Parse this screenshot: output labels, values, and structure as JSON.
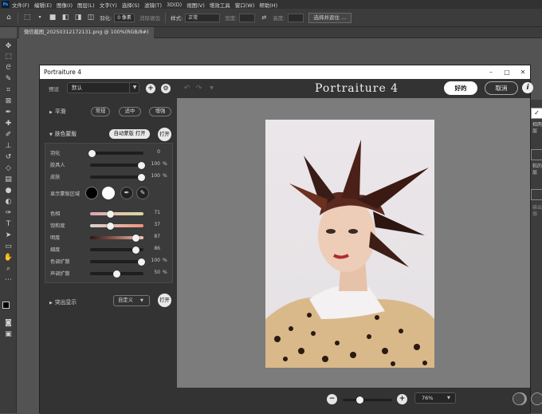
{
  "app": {
    "logo": "Ps",
    "menu": [
      "文件(F)",
      "编辑(E)",
      "图像(I)",
      "图层(L)",
      "文字(Y)",
      "选择(S)",
      "滤镜(T)",
      "3D(D)",
      "视图(V)",
      "增效工具",
      "窗口(W)",
      "帮助(H)"
    ]
  },
  "options": {
    "feather_label": "羽化:",
    "feather_value": "0 像素",
    "antialias_label": "消除锯齿",
    "style_label": "样式:",
    "style_value": "正常",
    "width_label": "宽度:",
    "height_label": "高度:",
    "select_mask_button": "选择并遮住 ..."
  },
  "document": {
    "tab_title": "微信截图_20250312172131.png @ 100%(RGB/8#)"
  },
  "right_panel": {
    "text1": "相两 层",
    "text2": "粘的 层",
    "text3": "输出 器"
  },
  "plugin": {
    "window_title": "Portraiture 4",
    "brand": "Portraiture 4",
    "preset_label": "预设",
    "preset_value": "默认",
    "ok_label": "好的",
    "cancel_label": "取消",
    "sections": {
      "smoothing": {
        "title": "平滑",
        "options": [
          "常规",
          "适中",
          "增强"
        ],
        "selected": "适中"
      },
      "skin_mask": {
        "title": "肤色蒙版",
        "auto_mask_label": "自动蒙版 打开",
        "toggle_label": "打开",
        "sliders_top": [
          {
            "label": "羽化",
            "value": "0",
            "unit": "",
            "frac": 0.03
          },
          {
            "label": "胶具人",
            "value": "100",
            "unit": "%",
            "frac": 0.97
          },
          {
            "label": "皮肤",
            "value": "100",
            "unit": "%",
            "frac": 0.97
          }
        ],
        "show_mask_label": "显示蒙版区域",
        "sliders_color": [
          {
            "label": "色相",
            "value": "71",
            "unit": "",
            "frac": 0.38
          },
          {
            "label": "饱和度",
            "value": "37",
            "unit": "",
            "frac": 0.38
          },
          {
            "label": "明度",
            "value": "87",
            "unit": "",
            "frac": 0.86
          },
          {
            "label": "细度",
            "value": "86",
            "unit": "",
            "frac": 0.86
          },
          {
            "label": "色调扩散",
            "value": "100",
            "unit": "%",
            "frac": 0.97
          },
          {
            "label": "声调扩散",
            "value": "50",
            "unit": "%",
            "frac": 0.5
          }
        ]
      },
      "enhance": {
        "title": "突出显示",
        "mode_value": "自定义",
        "toggle_label": "打开"
      }
    },
    "zoom": {
      "value": "76%",
      "slider_frac": 0.35
    },
    "colors": {
      "accent": "#ffffff",
      "panel": "#333333",
      "preview_bg": "#7c7c7c"
    }
  }
}
